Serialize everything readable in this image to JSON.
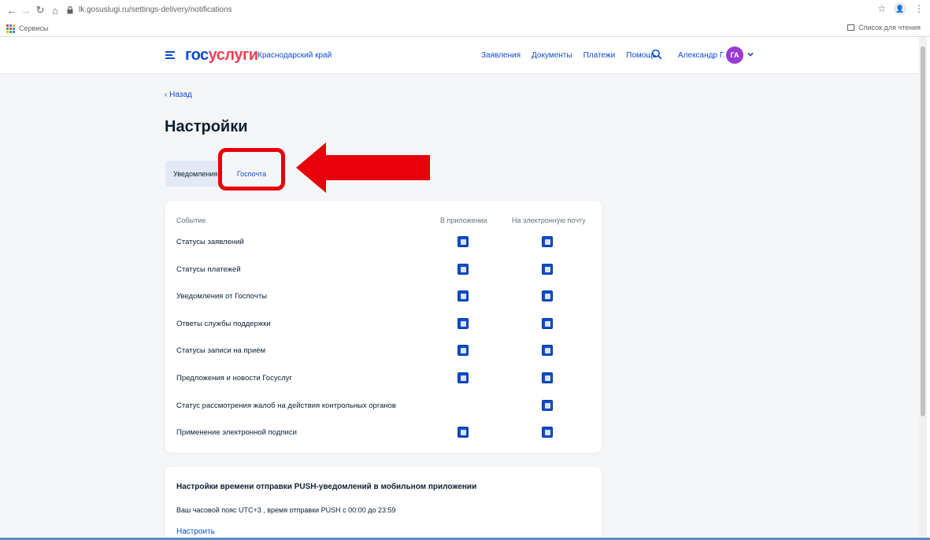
{
  "browser": {
    "url": "lk.gosuslugi.ru/settings-delivery/notifications",
    "bookmark_apps_label": "Сервисы",
    "reading_list_label": "Список для чтения"
  },
  "header": {
    "logo_part1": "гос",
    "logo_part2": "услуги",
    "region": "Краснодарский край",
    "nav": [
      "Заявления",
      "Документы",
      "Платежи",
      "Помощь"
    ],
    "user_name": "Александр Г.",
    "avatar_initials": "ГА"
  },
  "page": {
    "back_label": "‹ Назад",
    "title": "Настройки",
    "tabs": [
      {
        "label": "Уведомления",
        "active": true
      },
      {
        "label": "Госпочта",
        "active": false
      }
    ]
  },
  "settings_table": {
    "col_event": "Событие",
    "col_app": "В приложении",
    "col_email": "На электронную почту",
    "rows": [
      {
        "label": "Статусы заявлений",
        "app": true,
        "email": true
      },
      {
        "label": "Статусы платежей",
        "app": true,
        "email": true
      },
      {
        "label": "Уведомления от Госпочты",
        "app": true,
        "email": true
      },
      {
        "label": "Ответы службы поддержки",
        "app": true,
        "email": true
      },
      {
        "label": "Статусы записи на приём",
        "app": true,
        "email": true
      },
      {
        "label": "Предложения и новости Госуслуг",
        "app": true,
        "email": true
      },
      {
        "label": "Статус рассмотрения жалоб на действия контрольных органов",
        "app": null,
        "email": true
      },
      {
        "label": "Применение электронной подписи",
        "app": true,
        "email": true
      }
    ]
  },
  "push": {
    "title": "Настройки времени отправки PUSH-уведомлений в мобильном приложении",
    "description": "Ваш часовой пояс UTC+3 , время отправки PUSH с 00:00 до 23:59",
    "link": "Настроить"
  },
  "colors": {
    "primary": "#0d4cd3",
    "logo_red": "#ee3f58",
    "highlight_red": "#e8000b",
    "avatar": "#9a3ad3"
  }
}
